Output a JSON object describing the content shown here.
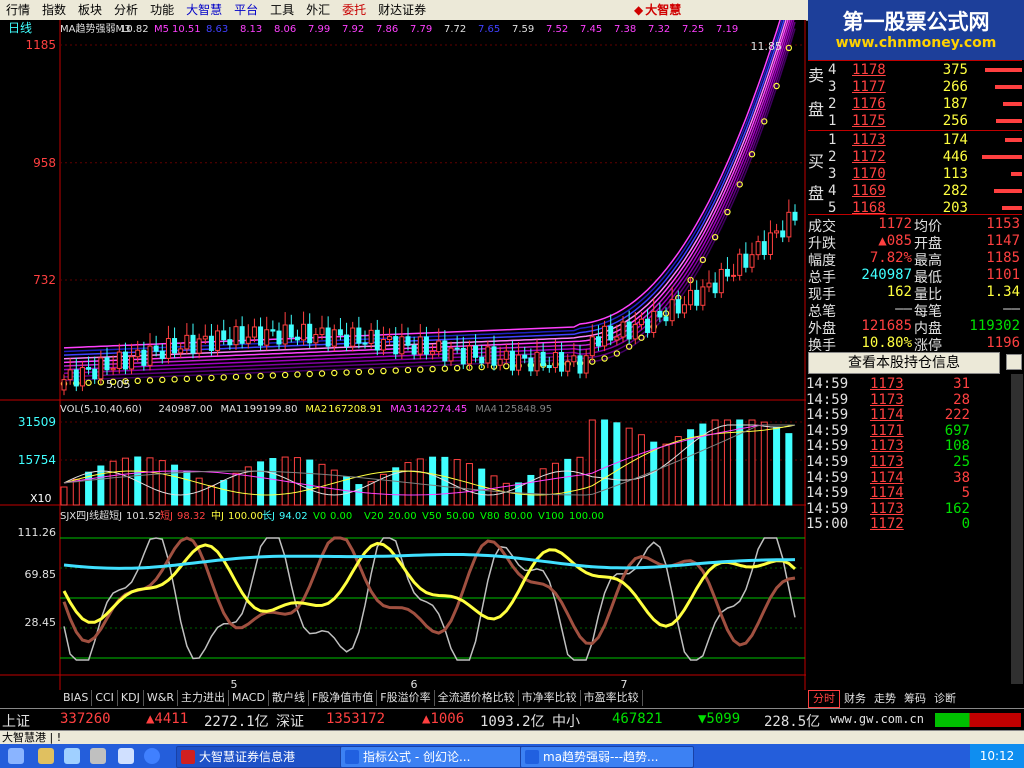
{
  "menu": {
    "items": [
      {
        "label": "行情",
        "style": ""
      },
      {
        "label": "指数",
        "style": ""
      },
      {
        "label": "板块",
        "style": ""
      },
      {
        "label": "分析",
        "style": ""
      },
      {
        "label": "功能",
        "style": ""
      },
      {
        "label": "大智慧",
        "style": "blue"
      },
      {
        "label": "平台",
        "style": "blue"
      },
      {
        "label": "工具",
        "style": ""
      },
      {
        "label": "外汇",
        "style": ""
      },
      {
        "label": "委托",
        "style": "red"
      },
      {
        "label": "财达证券",
        "style": ""
      }
    ],
    "brand": "大智慧"
  },
  "watermark": {
    "line1": "第一股票公式网",
    "line2": "www.chnmoney.com"
  },
  "chart": {
    "period": "日线",
    "ma_legend": [
      {
        "label": "MA趋势强弱M3",
        "value": "10.82",
        "color": "#e0e0e0"
      },
      {
        "label": "M5",
        "value": "10.51",
        "color": "#ff40ff"
      },
      {
        "label": "",
        "value": "8.63",
        "color": "#4040ff"
      },
      {
        "label": "",
        "value": "8.13",
        "color": "#ff40ff"
      },
      {
        "label": "",
        "value": "8.06",
        "color": "#ff40ff"
      },
      {
        "label": "",
        "value": "7.99",
        "color": "#ff40ff"
      },
      {
        "label": "",
        "value": "7.92",
        "color": "#ff40ff"
      },
      {
        "label": "",
        "value": "7.86",
        "color": "#ff40ff"
      },
      {
        "label": "",
        "value": "7.79",
        "color": "#ff40ff"
      },
      {
        "label": "",
        "value": "7.72",
        "color": "#e0e0e0"
      },
      {
        "label": "",
        "value": "7.65",
        "color": "#4040ff"
      },
      {
        "label": "",
        "value": "7.59",
        "color": "#e0e0e0"
      },
      {
        "label": "",
        "value": "7.52",
        "color": "#ff40ff"
      },
      {
        "label": "",
        "value": "7.45",
        "color": "#ff40ff"
      },
      {
        "label": "",
        "value": "7.38",
        "color": "#ff40ff"
      },
      {
        "label": "",
        "value": "7.32",
        "color": "#ff40ff"
      },
      {
        "label": "",
        "value": "7.25",
        "color": "#ff40ff"
      },
      {
        "label": "",
        "value": "7.19",
        "color": "#ff40ff"
      }
    ],
    "price_ticks": [
      "1185",
      "958",
      "732"
    ],
    "high_label": "11.85",
    "low_label": "5.05",
    "vol_legend": [
      {
        "label": "VOL(5,10,40,60)",
        "value": "240987.00",
        "color": "#e0e0e0"
      },
      {
        "label": "MA1",
        "value": "199199.80",
        "color": "#e0e0e0"
      },
      {
        "label": "MA2",
        "value": "167208.91",
        "color": "#ffff40"
      },
      {
        "label": "MA3",
        "value": "142274.45",
        "color": "#ff40ff"
      },
      {
        "label": "MA4",
        "value": "125848.95",
        "color": "#808080"
      }
    ],
    "vol_ticks": [
      "31509",
      "15754"
    ],
    "vol_unit": "X10",
    "ind_legend": [
      {
        "label": "SJX四J线超短J",
        "value": "101.52",
        "color": "#e0e0e0"
      },
      {
        "label": "短J",
        "value": "98.32",
        "color": "#ff4040"
      },
      {
        "label": "中J",
        "value": "100.00",
        "color": "#ffff40"
      },
      {
        "label": "长J",
        "value": "94.02",
        "color": "#40ffff"
      },
      {
        "label": "V0",
        "value": "0.00",
        "color": "#00ff00"
      },
      {
        "label": "V20",
        "value": "20.00",
        "color": "#00ff00"
      },
      {
        "label": "V50",
        "value": "50.00",
        "color": "#00ff00"
      },
      {
        "label": "V80",
        "value": "80.00",
        "color": "#00ff00"
      },
      {
        "label": "V100",
        "value": "100.00",
        "color": "#00ff00"
      }
    ],
    "ind_ticks": [
      "111.26",
      "69.85",
      "28.45"
    ],
    "x_labels": [
      "5",
      "6",
      "7"
    ]
  },
  "order_book": {
    "sell_label_top": "卖",
    "sell_label_bot": "盘",
    "buy_label_top": "买",
    "buy_label_bot": "盘",
    "sell": [
      {
        "lvl": "4",
        "price": "1178",
        "vol": "375"
      },
      {
        "lvl": "3",
        "price": "1177",
        "vol": "266"
      },
      {
        "lvl": "2",
        "price": "1176",
        "vol": "187"
      },
      {
        "lvl": "1",
        "price": "1175",
        "vol": "256"
      }
    ],
    "buy": [
      {
        "lvl": "1",
        "price": "1173",
        "vol": "174"
      },
      {
        "lvl": "2",
        "price": "1172",
        "vol": "446"
      },
      {
        "lvl": "3",
        "price": "1170",
        "vol": "113"
      },
      {
        "lvl": "4",
        "price": "1169",
        "vol": "282"
      },
      {
        "lvl": "5",
        "price": "1168",
        "vol": "203"
      }
    ]
  },
  "stats": [
    {
      "l1": "成交",
      "v1": "1172",
      "c1": "red",
      "l2": "均价",
      "v2": "1153",
      "c2": "red"
    },
    {
      "l1": "升跌",
      "v1": "▲085",
      "c1": "red",
      "l2": "开盘",
      "v2": "1147",
      "c2": "red"
    },
    {
      "l1": "幅度",
      "v1": "7.82%",
      "c1": "red",
      "l2": "最高",
      "v2": "1185",
      "c2": "red"
    },
    {
      "l1": "总手",
      "v1": "240987",
      "c1": "cyn",
      "l2": "最低",
      "v2": "1101",
      "c2": "red"
    },
    {
      "l1": "现手",
      "v1": "162",
      "c1": "yel",
      "l2": "量比",
      "v2": "1.34",
      "c2": "yel"
    },
    {
      "l1": "总笔",
      "v1": "——",
      "c1": "wht",
      "l2": "每笔",
      "v2": "——",
      "c2": "wht"
    },
    {
      "l1": "外盘",
      "v1": "121685",
      "c1": "red",
      "l2": "内盘",
      "v2": "119302",
      "c2": "grn"
    },
    {
      "l1": "换手",
      "v1": "10.80%",
      "c1": "yel",
      "l2": "涨停",
      "v2": "1196",
      "c2": "red"
    }
  ],
  "hold_button": "查看本股持仓信息",
  "ticks": [
    {
      "t": "14:59",
      "p": "1173",
      "v": "31",
      "vc": "red"
    },
    {
      "t": "14:59",
      "p": "1173",
      "v": "28",
      "vc": "red"
    },
    {
      "t": "14:59",
      "p": "1174",
      "v": "222",
      "vc": "red"
    },
    {
      "t": "14:59",
      "p": "1171",
      "v": "697",
      "vc": "grn"
    },
    {
      "t": "14:59",
      "p": "1173",
      "v": "108",
      "vc": "grn"
    },
    {
      "t": "14:59",
      "p": "1173",
      "v": "25",
      "vc": "grn"
    },
    {
      "t": "14:59",
      "p": "1174",
      "v": "38",
      "vc": "red"
    },
    {
      "t": "14:59",
      "p": "1174",
      "v": "5",
      "vc": "red"
    },
    {
      "t": "14:59",
      "p": "1173",
      "v": "162",
      "vc": "grn"
    },
    {
      "t": "15:00",
      "p": "1172",
      "v": "0",
      "vc": "grn"
    }
  ],
  "bottom_tabs": [
    "BIAS",
    "CCI",
    "KDJ",
    "W&R",
    "主力进出",
    "MACD",
    "散户线",
    "F股净值市值",
    "F股溢价率",
    "全流通价格比较",
    "市净率比较",
    "市盈率比较"
  ],
  "right_tabs": [
    {
      "label": "分时",
      "active": true
    },
    {
      "label": "财务",
      "active": false
    },
    {
      "label": "走势",
      "active": false
    },
    {
      "label": "筹码",
      "active": false
    },
    {
      "label": "诊断",
      "active": false
    }
  ],
  "index_bar": {
    "sh_label": "上证",
    "sh_val": "337260",
    "sh_chg": "▲4411",
    "sh_amt": "2272.1亿",
    "sz_label": "深证",
    "sz_val": "1353172",
    "sz_chg": "▲1006",
    "sz_amt": "1093.2亿",
    "zx_label": "中小",
    "zx_val": "467821",
    "zx_chg": "▼5099",
    "zx_amt": "228.5亿",
    "url": "www.gw.com.cn"
  },
  "status_text": "大智慧港 | !",
  "taskbar": [
    {
      "label": "大智慧证券信息港",
      "active": true,
      "icon": "#d02020"
    },
    {
      "label": "指标公式 - 创幻论...",
      "active": false,
      "icon": "#2060e0"
    },
    {
      "label": "ma趋势强弱---趋势...",
      "active": false,
      "icon": "#2060e0"
    }
  ],
  "clock": "10:12",
  "colors": {
    "up": "#ff4040",
    "down": "#40ffff",
    "bg": "#000000"
  }
}
